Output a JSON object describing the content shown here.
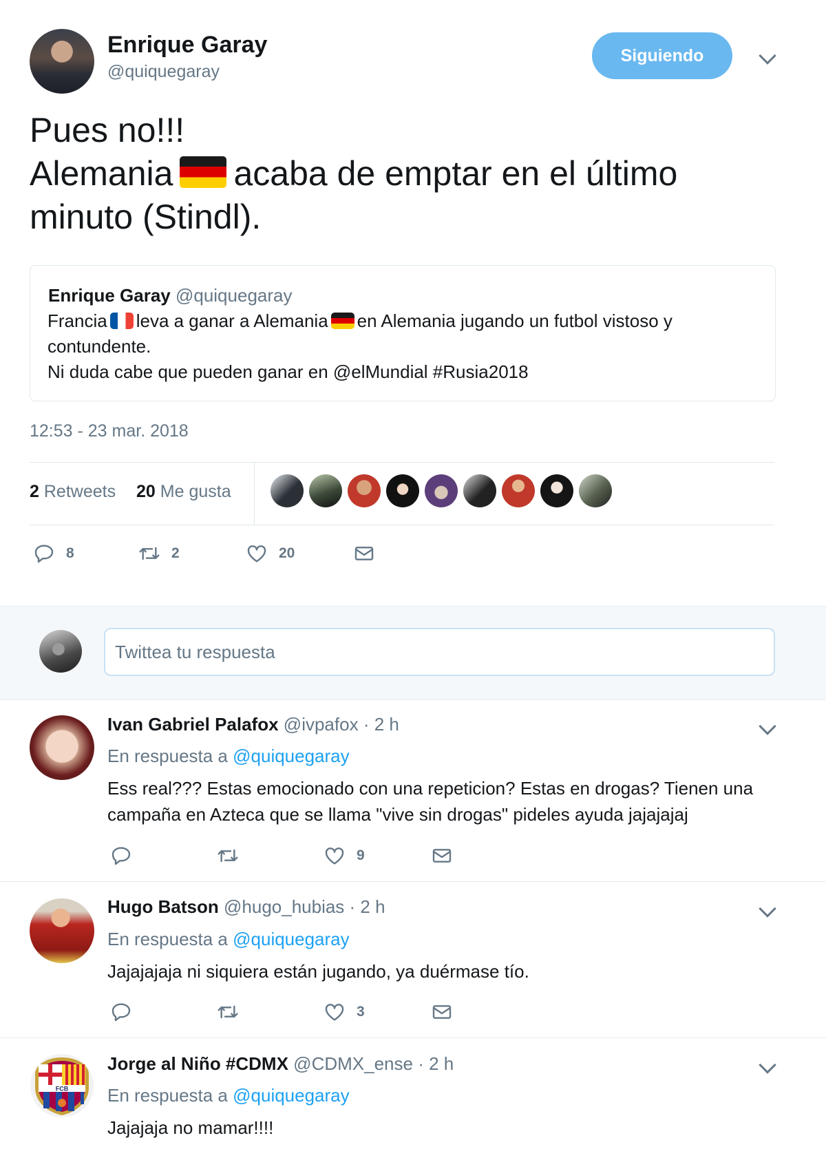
{
  "tweet": {
    "author_name": "Enrique Garay",
    "author_handle": "@quiquegaray",
    "follow_label": "Siguiendo",
    "text_line1": "Pues no!!!",
    "text_line2a": "Alemania",
    "text_line2b": "acaba de emptar en el último",
    "text_line3": "minuto (Stindl).",
    "timestamp": "12:53 - 23 mar. 2018"
  },
  "quoted": {
    "author_name": "Enrique Garay",
    "author_handle": "@quiquegaray",
    "text_a": "Francia",
    "text_b": "leva a ganar a Alemania",
    "text_c": "en Alemania jugando un futbol vistoso y contundente.",
    "text_line3": "Ni duda cabe que pueden ganar en @elMundial #Rusia2018"
  },
  "stats": {
    "retweets_count": "2",
    "retweets_label": "Retweets",
    "likes_count": "20",
    "likes_label": "Me gusta"
  },
  "actions": {
    "replies": "8",
    "retweets": "2",
    "likes": "20"
  },
  "reply_box": {
    "placeholder": "Twittea tu respuesta"
  },
  "replies": [
    {
      "name": "Ivan Gabriel Palafox",
      "handle": "@ivpafox",
      "time": "· 2 h",
      "context_prefix": "En respuesta a",
      "context_handle": "@quiquegaray",
      "text": "Ess real??? Estas emocionado con una repeticion? Estas en drogas? Tienen una campaña en Azteca que se llama \"vive sin drogas\" pideles ayuda jajajajaj",
      "likes": "9"
    },
    {
      "name": "Hugo Batson",
      "handle": "@hugo_hubias",
      "time": "· 2 h",
      "context_prefix": "En respuesta a",
      "context_handle": "@quiquegaray",
      "text": "Jajajajaja ni siquiera están jugando, ya duérmase tío.",
      "likes": "3"
    },
    {
      "name": "Jorge al Niño #CDMX",
      "handle": "@CDMX_ense",
      "time": "· 2 h",
      "context_prefix": "En respuesta a",
      "context_handle": "@quiquegaray",
      "text": "Jajajaja no mamar!!!!",
      "logo_text": "FCB"
    }
  ],
  "icons": {
    "reply": "reply-icon",
    "retweet": "retweet-icon",
    "like": "heart-icon",
    "dm": "envelope-icon",
    "more": "chevron-down-icon"
  },
  "colors": {
    "follow_button": "#69b8f0",
    "link": "#1da1f2",
    "muted": "#657786"
  }
}
